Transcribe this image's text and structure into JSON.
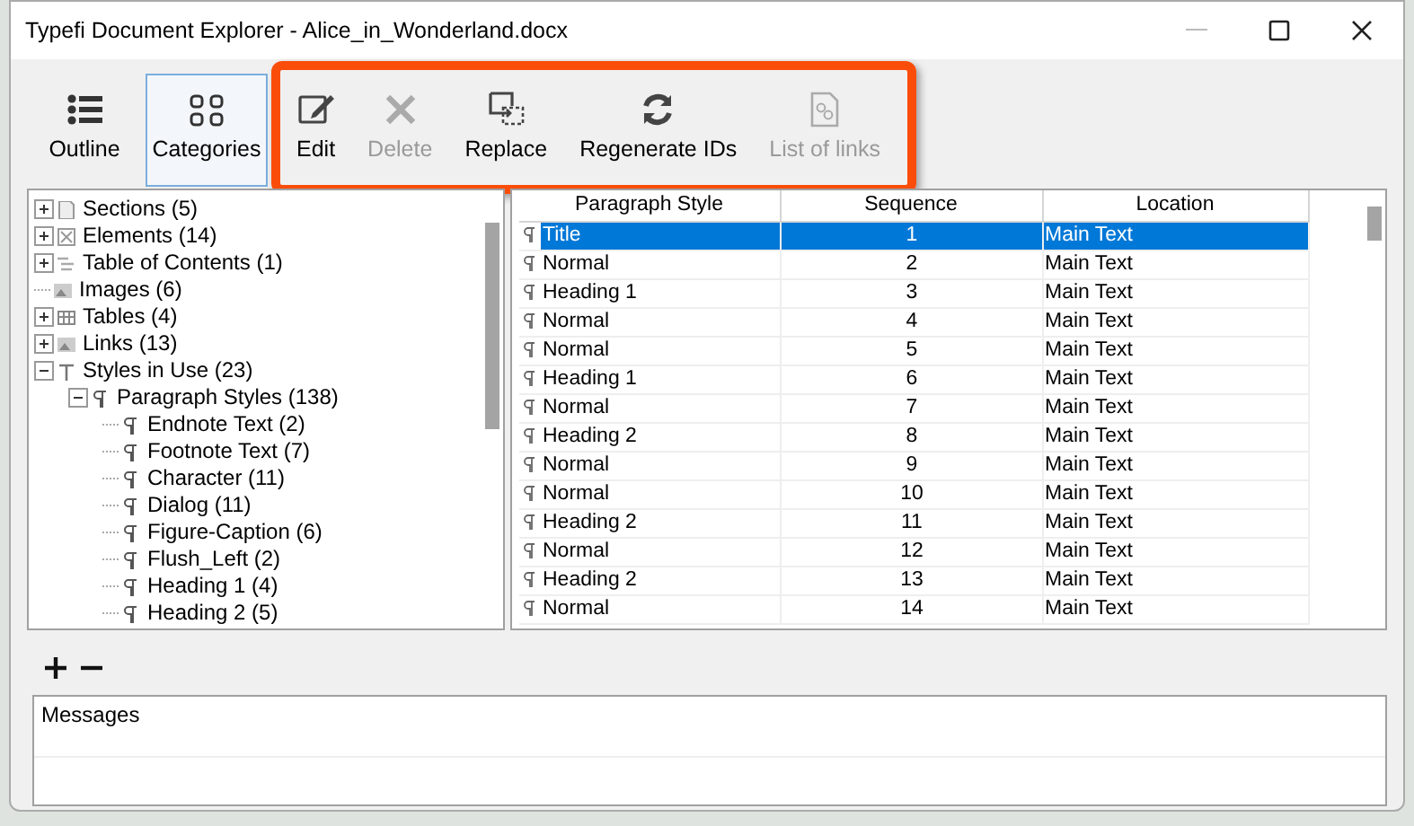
{
  "window": {
    "title": "Typefi Document Explorer - Alice_in_Wonderland.docx"
  },
  "views": [
    {
      "label": "Outline",
      "selected": false
    },
    {
      "label": "Categories",
      "selected": true
    }
  ],
  "actions": [
    {
      "label": "Edit",
      "disabled": false
    },
    {
      "label": "Delete",
      "disabled": true
    },
    {
      "label": "Replace",
      "disabled": false
    },
    {
      "label": "Regenerate IDs",
      "disabled": false
    },
    {
      "label": "List of links",
      "disabled": true
    }
  ],
  "tree": [
    {
      "label": "Sections (5)",
      "kind": "section",
      "expanded": false
    },
    {
      "label": "Elements (14)",
      "kind": "element",
      "expanded": false
    },
    {
      "label": "Table of Contents (1)",
      "kind": "toc",
      "expanded": false
    },
    {
      "label": "Images (6)",
      "kind": "image"
    },
    {
      "label": "Tables (4)",
      "kind": "table",
      "expanded": false
    },
    {
      "label": "Links (13)",
      "kind": "link",
      "expanded": false
    },
    {
      "label": "Styles in Use (23)",
      "kind": "styles",
      "expanded": true,
      "children": [
        {
          "label": "Paragraph Styles (138)",
          "kind": "paragraph",
          "expanded": true,
          "children": [
            {
              "label": "Endnote Text (2)",
              "kind": "paragraph"
            },
            {
              "label": "Footnote Text (7)",
              "kind": "paragraph"
            },
            {
              "label": "Character (11)",
              "kind": "paragraph"
            },
            {
              "label": "Dialog (11)",
              "kind": "paragraph"
            },
            {
              "label": "Figure-Caption (6)",
              "kind": "paragraph"
            },
            {
              "label": "Flush_Left (2)",
              "kind": "paragraph"
            },
            {
              "label": "Heading 1 (4)",
              "kind": "paragraph"
            },
            {
              "label": "Heading 2 (5)",
              "kind": "paragraph"
            }
          ]
        }
      ]
    }
  ],
  "table": {
    "columns": [
      "Paragraph Style",
      "Sequence",
      "Location"
    ],
    "rows": [
      {
        "style": "Title",
        "sequence": "1",
        "location": "Main Text",
        "selected": true
      },
      {
        "style": "Normal",
        "sequence": "2",
        "location": "Main Text",
        "selected": false
      },
      {
        "style": "Heading 1",
        "sequence": "3",
        "location": "Main Text",
        "selected": false
      },
      {
        "style": "Normal",
        "sequence": "4",
        "location": "Main Text",
        "selected": false
      },
      {
        "style": "Normal",
        "sequence": "5",
        "location": "Main Text",
        "selected": false
      },
      {
        "style": "Heading 1",
        "sequence": "6",
        "location": "Main Text",
        "selected": false
      },
      {
        "style": "Normal",
        "sequence": "7",
        "location": "Main Text",
        "selected": false
      },
      {
        "style": "Heading 2",
        "sequence": "8",
        "location": "Main Text",
        "selected": false
      },
      {
        "style": "Normal",
        "sequence": "9",
        "location": "Main Text",
        "selected": false
      },
      {
        "style": "Normal",
        "sequence": "10",
        "location": "Main Text",
        "selected": false
      },
      {
        "style": "Heading 2",
        "sequence": "11",
        "location": "Main Text",
        "selected": false
      },
      {
        "style": "Normal",
        "sequence": "12",
        "location": "Main Text",
        "selected": false
      },
      {
        "style": "Heading 2",
        "sequence": "13",
        "location": "Main Text",
        "selected": false
      },
      {
        "style": "Normal",
        "sequence": "14",
        "location": "Main Text",
        "selected": false
      }
    ]
  },
  "messages": {
    "title": "Messages"
  }
}
